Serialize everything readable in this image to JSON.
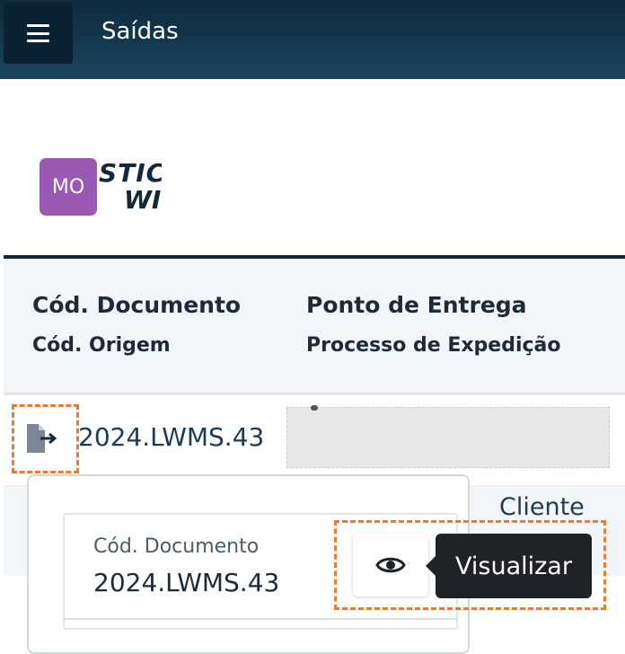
{
  "header": {
    "title": "Saídas",
    "menu_icon": "hamburger-menu-icon"
  },
  "brand": {
    "avatar_initials": "MO",
    "avatar_color": "#9b59b6",
    "logo_line1": "STIC",
    "logo_line2": "WI"
  },
  "table": {
    "columns": [
      {
        "title": "Cód. Documento",
        "subtitle": "Cód. Origem"
      },
      {
        "title": "Ponto de Entrega",
        "subtitle": "Processo de Expedição"
      }
    ],
    "rows": [
      {
        "doc_code": "2024.LWMS.43",
        "action_icon": "file-export-icon"
      }
    ],
    "row2_partial_text": "Cliente"
  },
  "popover": {
    "field_label": "Cód. Documento",
    "field_value": "2024.LWMS.43",
    "view_icon": "eye-icon"
  },
  "tooltip": {
    "text": "Visualizar"
  },
  "colors": {
    "header_bg": "#14283a",
    "highlight": "#e87b35"
  }
}
